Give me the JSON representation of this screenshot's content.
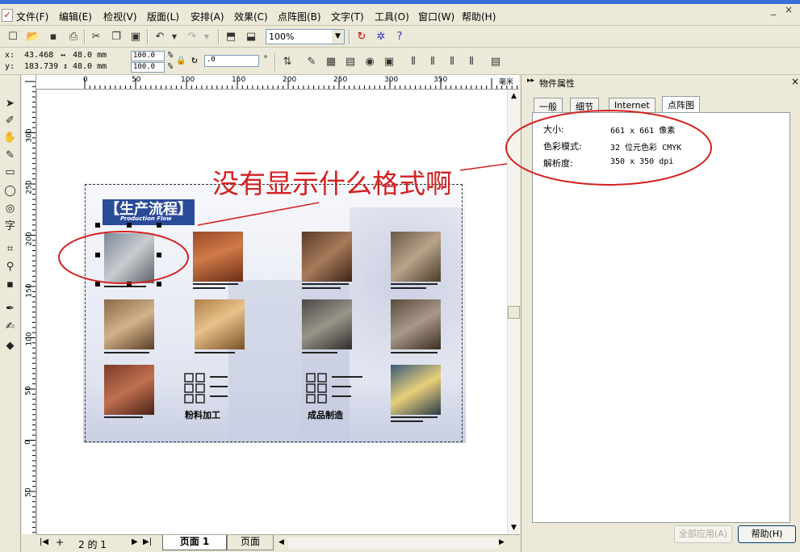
{
  "menu": [
    "文件(F)",
    "编辑(E)",
    "检视(V)",
    "版面(L)",
    "安排(A)",
    "效果(C)",
    "点阵图(B)",
    "文字(T)",
    "工具(O)",
    "窗口(W)",
    "帮助(H)"
  ],
  "toolbar": {
    "zoom": "100%"
  },
  "propbar": {
    "x_label": "x:",
    "x_value": "43.468",
    "y_label": "y:",
    "y_value": "183.739",
    "w_value": "48.0 mm",
    "h_value": "48.0 mm",
    "sx_value": "100.0",
    "sy_value": "100.0",
    "pct1": "%",
    "pct2": "%",
    "angle_value": ".0",
    "deg": "°"
  },
  "ruler": {
    "h_ticks": [
      "0",
      "50",
      "100",
      "150",
      "200",
      "250",
      "300",
      "350"
    ],
    "unit": "毫米",
    "v_ticks": [
      "300",
      "250",
      "200",
      "150",
      "100",
      "50",
      "0",
      "50"
    ]
  },
  "annotation": {
    "text": "没有显示什么格式啊"
  },
  "doc": {
    "banner_cn": "【生产流程】",
    "banner_en": "Production Flow",
    "label_left": "粉料加工",
    "label_right": "成品制造"
  },
  "page_nav": {
    "pager": "2 的 1",
    "tab1": "页面  1",
    "tab2": "页面"
  },
  "panel": {
    "title": "物件属性",
    "tabs": [
      "一般",
      "细节",
      "Internet",
      "点阵图"
    ],
    "rows": [
      {
        "key": "大小:",
        "value": "661 x 661 像素"
      },
      {
        "key": "色彩模式:",
        "value": "32 位元色彩  CMYK"
      },
      {
        "key": "解析度:",
        "value": "350 x 350 dpi"
      }
    ],
    "apply_all": "全部应用(A)",
    "help": "帮助(H)"
  },
  "colors": {
    "annotation_red": "#d42020",
    "banner_blue": "#2a4a9a",
    "selection_box": "#000000"
  }
}
